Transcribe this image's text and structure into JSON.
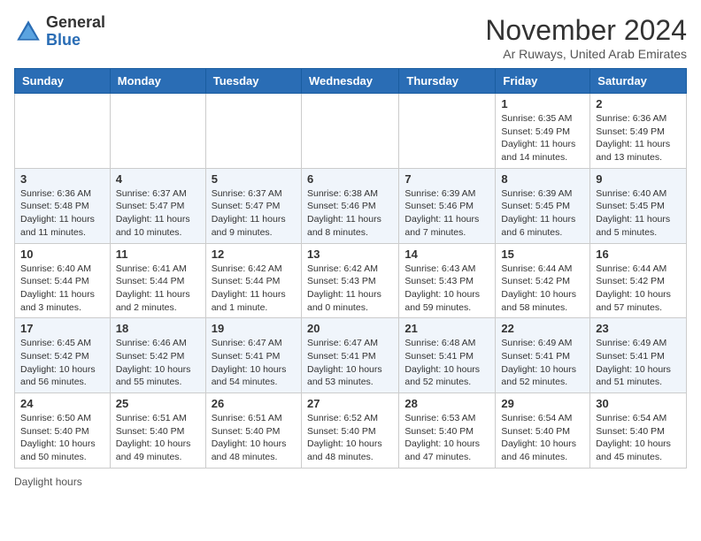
{
  "logo": {
    "general": "General",
    "blue": "Blue"
  },
  "header": {
    "month": "November 2024",
    "location": "Ar Ruways, United Arab Emirates"
  },
  "days_of_week": [
    "Sunday",
    "Monday",
    "Tuesday",
    "Wednesday",
    "Thursday",
    "Friday",
    "Saturday"
  ],
  "footer": {
    "daylight_label": "Daylight hours"
  },
  "weeks": [
    [
      {
        "day": "",
        "info": ""
      },
      {
        "day": "",
        "info": ""
      },
      {
        "day": "",
        "info": ""
      },
      {
        "day": "",
        "info": ""
      },
      {
        "day": "",
        "info": ""
      },
      {
        "day": "1",
        "info": "Sunrise: 6:35 AM\nSunset: 5:49 PM\nDaylight: 11 hours and 14 minutes."
      },
      {
        "day": "2",
        "info": "Sunrise: 6:36 AM\nSunset: 5:49 PM\nDaylight: 11 hours and 13 minutes."
      }
    ],
    [
      {
        "day": "3",
        "info": "Sunrise: 6:36 AM\nSunset: 5:48 PM\nDaylight: 11 hours and 11 minutes."
      },
      {
        "day": "4",
        "info": "Sunrise: 6:37 AM\nSunset: 5:47 PM\nDaylight: 11 hours and 10 minutes."
      },
      {
        "day": "5",
        "info": "Sunrise: 6:37 AM\nSunset: 5:47 PM\nDaylight: 11 hours and 9 minutes."
      },
      {
        "day": "6",
        "info": "Sunrise: 6:38 AM\nSunset: 5:46 PM\nDaylight: 11 hours and 8 minutes."
      },
      {
        "day": "7",
        "info": "Sunrise: 6:39 AM\nSunset: 5:46 PM\nDaylight: 11 hours and 7 minutes."
      },
      {
        "day": "8",
        "info": "Sunrise: 6:39 AM\nSunset: 5:45 PM\nDaylight: 11 hours and 6 minutes."
      },
      {
        "day": "9",
        "info": "Sunrise: 6:40 AM\nSunset: 5:45 PM\nDaylight: 11 hours and 5 minutes."
      }
    ],
    [
      {
        "day": "10",
        "info": "Sunrise: 6:40 AM\nSunset: 5:44 PM\nDaylight: 11 hours and 3 minutes."
      },
      {
        "day": "11",
        "info": "Sunrise: 6:41 AM\nSunset: 5:44 PM\nDaylight: 11 hours and 2 minutes."
      },
      {
        "day": "12",
        "info": "Sunrise: 6:42 AM\nSunset: 5:44 PM\nDaylight: 11 hours and 1 minute."
      },
      {
        "day": "13",
        "info": "Sunrise: 6:42 AM\nSunset: 5:43 PM\nDaylight: 11 hours and 0 minutes."
      },
      {
        "day": "14",
        "info": "Sunrise: 6:43 AM\nSunset: 5:43 PM\nDaylight: 10 hours and 59 minutes."
      },
      {
        "day": "15",
        "info": "Sunrise: 6:44 AM\nSunset: 5:42 PM\nDaylight: 10 hours and 58 minutes."
      },
      {
        "day": "16",
        "info": "Sunrise: 6:44 AM\nSunset: 5:42 PM\nDaylight: 10 hours and 57 minutes."
      }
    ],
    [
      {
        "day": "17",
        "info": "Sunrise: 6:45 AM\nSunset: 5:42 PM\nDaylight: 10 hours and 56 minutes."
      },
      {
        "day": "18",
        "info": "Sunrise: 6:46 AM\nSunset: 5:42 PM\nDaylight: 10 hours and 55 minutes."
      },
      {
        "day": "19",
        "info": "Sunrise: 6:47 AM\nSunset: 5:41 PM\nDaylight: 10 hours and 54 minutes."
      },
      {
        "day": "20",
        "info": "Sunrise: 6:47 AM\nSunset: 5:41 PM\nDaylight: 10 hours and 53 minutes."
      },
      {
        "day": "21",
        "info": "Sunrise: 6:48 AM\nSunset: 5:41 PM\nDaylight: 10 hours and 52 minutes."
      },
      {
        "day": "22",
        "info": "Sunrise: 6:49 AM\nSunset: 5:41 PM\nDaylight: 10 hours and 52 minutes."
      },
      {
        "day": "23",
        "info": "Sunrise: 6:49 AM\nSunset: 5:41 PM\nDaylight: 10 hours and 51 minutes."
      }
    ],
    [
      {
        "day": "24",
        "info": "Sunrise: 6:50 AM\nSunset: 5:40 PM\nDaylight: 10 hours and 50 minutes."
      },
      {
        "day": "25",
        "info": "Sunrise: 6:51 AM\nSunset: 5:40 PM\nDaylight: 10 hours and 49 minutes."
      },
      {
        "day": "26",
        "info": "Sunrise: 6:51 AM\nSunset: 5:40 PM\nDaylight: 10 hours and 48 minutes."
      },
      {
        "day": "27",
        "info": "Sunrise: 6:52 AM\nSunset: 5:40 PM\nDaylight: 10 hours and 48 minutes."
      },
      {
        "day": "28",
        "info": "Sunrise: 6:53 AM\nSunset: 5:40 PM\nDaylight: 10 hours and 47 minutes."
      },
      {
        "day": "29",
        "info": "Sunrise: 6:54 AM\nSunset: 5:40 PM\nDaylight: 10 hours and 46 minutes."
      },
      {
        "day": "30",
        "info": "Sunrise: 6:54 AM\nSunset: 5:40 PM\nDaylight: 10 hours and 45 minutes."
      }
    ]
  ]
}
